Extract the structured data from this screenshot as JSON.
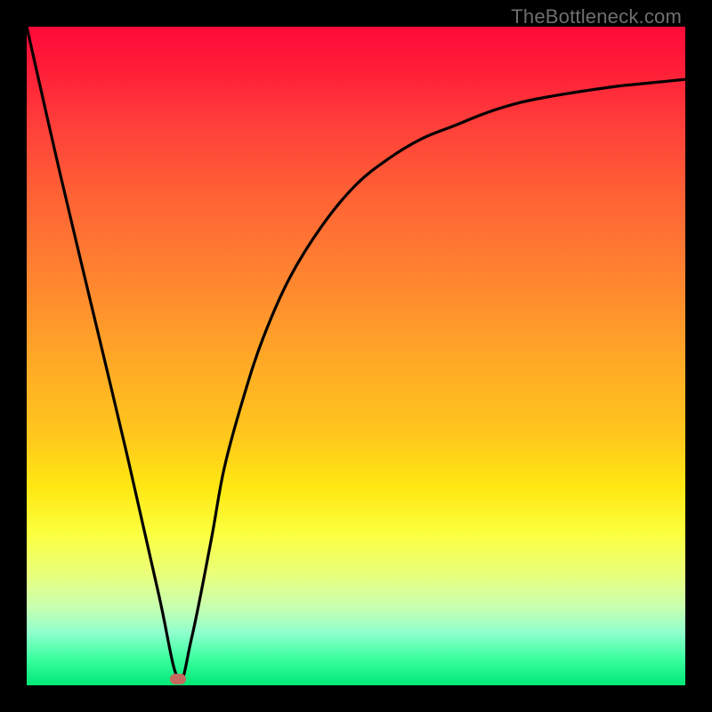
{
  "watermark": "TheBottleneck.com",
  "chart_data": {
    "type": "line",
    "title": "",
    "xlabel": "",
    "ylabel": "",
    "xlim": [
      0,
      100
    ],
    "ylim": [
      0,
      100
    ],
    "grid": false,
    "legend": false,
    "series": [
      {
        "name": "curve",
        "x": [
          0,
          5,
          10,
          15,
          20,
          23,
          25,
          28,
          30,
          33,
          36,
          40,
          45,
          50,
          55,
          60,
          65,
          70,
          75,
          80,
          85,
          90,
          95,
          100
        ],
        "y": [
          100,
          78,
          57,
          36,
          14,
          1,
          7,
          22,
          33,
          44,
          53,
          62,
          70,
          76,
          80,
          83,
          85,
          87,
          88.5,
          89.5,
          90.3,
          91,
          91.5,
          92
        ]
      }
    ],
    "marker": {
      "x": 23,
      "y": 1,
      "color": "#c46a5e"
    },
    "background_gradient": {
      "top": "#ff0a3a",
      "mid_upper": "#ff8430",
      "mid": "#ffe812",
      "mid_lower": "#c9ffb0",
      "bottom": "#00e876"
    },
    "frame_color": "#000000",
    "curve_color": "#000000"
  }
}
